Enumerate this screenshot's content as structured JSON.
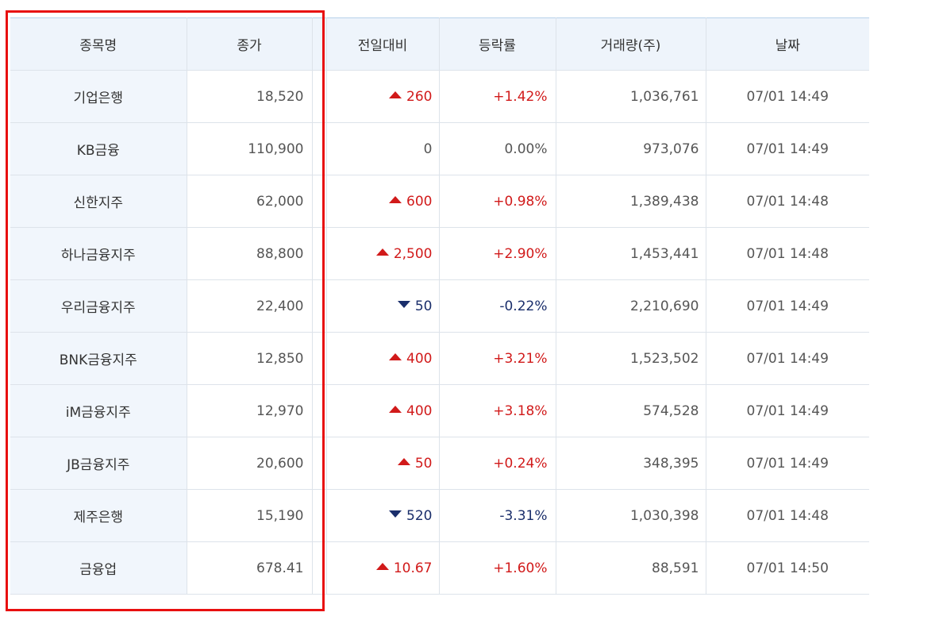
{
  "table": {
    "headers": {
      "name": "종목명",
      "close": "종가",
      "change": "전일대비",
      "rate": "등락률",
      "volume": "거래량(주)",
      "date": "날짜"
    },
    "rows": [
      {
        "name": "기업은행",
        "close": "18,520",
        "dir": "up",
        "change": "260",
        "rate": "+1.42%",
        "volume": "1,036,761",
        "date": "07/01 14:49"
      },
      {
        "name": "KB금융",
        "close": "110,900",
        "dir": "flat",
        "change": "0",
        "rate": "0.00%",
        "volume": "973,076",
        "date": "07/01 14:49"
      },
      {
        "name": "신한지주",
        "close": "62,000",
        "dir": "up",
        "change": "600",
        "rate": "+0.98%",
        "volume": "1,389,438",
        "date": "07/01 14:48"
      },
      {
        "name": "하나금융지주",
        "close": "88,800",
        "dir": "up",
        "change": "2,500",
        "rate": "+2.90%",
        "volume": "1,453,441",
        "date": "07/01 14:48"
      },
      {
        "name": "우리금융지주",
        "close": "22,400",
        "dir": "down",
        "change": "50",
        "rate": "-0.22%",
        "volume": "2,210,690",
        "date": "07/01 14:49"
      },
      {
        "name": "BNK금융지주",
        "close": "12,850",
        "dir": "up",
        "change": "400",
        "rate": "+3.21%",
        "volume": "1,523,502",
        "date": "07/01 14:49"
      },
      {
        "name": "iM금융지주",
        "close": "12,970",
        "dir": "up",
        "change": "400",
        "rate": "+3.18%",
        "volume": "574,528",
        "date": "07/01 14:49"
      },
      {
        "name": "JB금융지주",
        "close": "20,600",
        "dir": "up",
        "change": "50",
        "rate": "+0.24%",
        "volume": "348,395",
        "date": "07/01 14:49"
      },
      {
        "name": "제주은행",
        "close": "15,190",
        "dir": "down",
        "change": "520",
        "rate": "-3.31%",
        "volume": "1,030,398",
        "date": "07/01 14:48"
      },
      {
        "name": "금융업",
        "close": "678.41",
        "dir": "up",
        "change": "10.67",
        "rate": "+1.60%",
        "volume": "88,591",
        "date": "07/01 14:50"
      }
    ]
  },
  "colors": {
    "up": "#d11a1a",
    "down": "#1a2e6b",
    "highlight": "#e81010",
    "header_bg": "#eef4fb"
  },
  "icons": {
    "up": "triangle-up-icon",
    "down": "triangle-down-icon"
  }
}
